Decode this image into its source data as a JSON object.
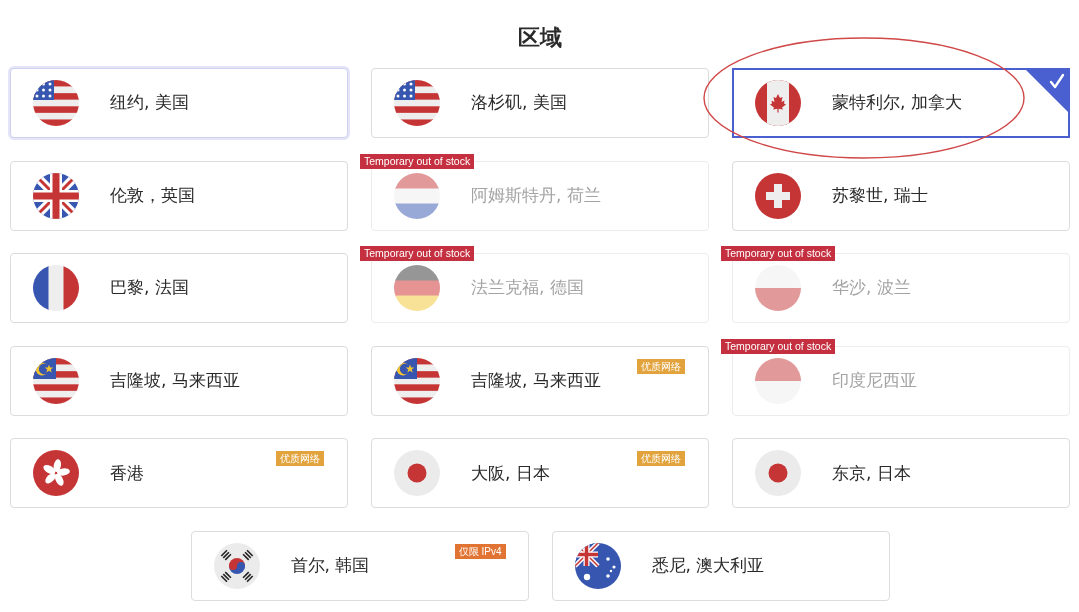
{
  "title": "区域",
  "regions": [
    {
      "name": "纽约, 美国",
      "kind": "us",
      "selected": false,
      "disabled": false,
      "hovered": true,
      "circled": false
    },
    {
      "name": "洛杉矶, 美国",
      "kind": "us",
      "selected": false,
      "disabled": false,
      "hovered": false,
      "circled": false
    },
    {
      "name": "蒙特利尔, 加拿大",
      "kind": "ca",
      "selected": true,
      "disabled": false,
      "hovered": false,
      "circled": true
    },
    {
      "name": "伦敦，英国",
      "kind": "gb",
      "selected": false,
      "disabled": false,
      "hovered": false,
      "circled": false
    },
    {
      "name": "阿姆斯特丹, 荷兰",
      "kind": "nl",
      "selected": false,
      "disabled": true,
      "hovered": false,
      "circled": false,
      "badge": {
        "kind": "stock",
        "text": "Temporary out of stock"
      }
    },
    {
      "name": "苏黎世, 瑞士",
      "kind": "ch",
      "selected": false,
      "disabled": false,
      "hovered": false,
      "circled": false
    },
    {
      "name": "巴黎, 法国",
      "kind": "fr",
      "selected": false,
      "disabled": false,
      "hovered": false,
      "circled": false
    },
    {
      "name": "法兰克福, 德国",
      "kind": "de",
      "selected": false,
      "disabled": true,
      "hovered": false,
      "circled": false,
      "badge": {
        "kind": "stock",
        "text": "Temporary out of stock"
      }
    },
    {
      "name": "华沙, 波兰",
      "kind": "pl",
      "selected": false,
      "disabled": true,
      "hovered": false,
      "circled": false,
      "badge": {
        "kind": "stock",
        "text": "Temporary out of stock"
      }
    },
    {
      "name": "吉隆坡, 马来西亚",
      "kind": "my",
      "selected": false,
      "disabled": false,
      "hovered": false,
      "circled": false
    },
    {
      "name": "吉隆坡, 马来西亚",
      "kind": "my",
      "selected": false,
      "disabled": false,
      "hovered": false,
      "circled": false,
      "badge": {
        "kind": "network",
        "text": "优质网络"
      }
    },
    {
      "name": "印度尼西亚",
      "kind": "id",
      "selected": false,
      "disabled": true,
      "hovered": false,
      "circled": false,
      "badge": {
        "kind": "stock",
        "text": "Temporary out of stock"
      }
    },
    {
      "name": "香港",
      "kind": "hk",
      "selected": false,
      "disabled": false,
      "hovered": false,
      "circled": false,
      "badge": {
        "kind": "network",
        "text": "优质网络"
      }
    },
    {
      "name": "大阪, 日本",
      "kind": "jp",
      "selected": false,
      "disabled": false,
      "hovered": false,
      "circled": false,
      "badge": {
        "kind": "network",
        "text": "优质网络"
      }
    },
    {
      "name": "东京, 日本",
      "kind": "jp",
      "selected": false,
      "disabled": false,
      "hovered": false,
      "circled": false
    },
    {
      "name": "首尔, 韩国",
      "kind": "kr",
      "selected": false,
      "disabled": false,
      "hovered": false,
      "circled": false,
      "badge": {
        "kind": "ipv4",
        "text": "仅限 IPv4"
      }
    },
    {
      "name": "悉尼, 澳大利亚",
      "kind": "au",
      "selected": false,
      "disabled": false,
      "hovered": false,
      "circled": false
    }
  ]
}
